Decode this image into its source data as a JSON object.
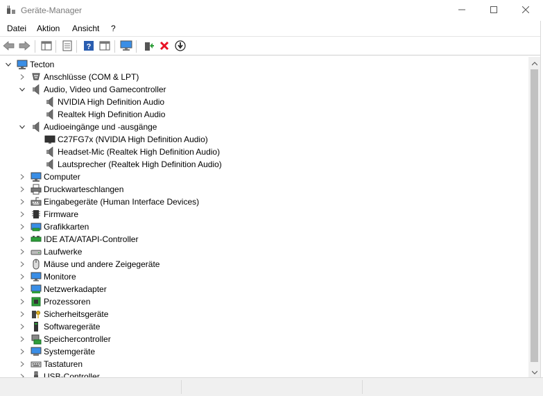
{
  "window": {
    "title": "Geräte-Manager",
    "icons": {
      "app": "device-manager-icon",
      "minimize": "minimize-icon",
      "maximize": "maximize-icon",
      "close": "close-icon"
    }
  },
  "menu": [
    "Datei",
    "Aktion",
    "Ansicht",
    "?"
  ],
  "toolbar": [
    "back-arrow-icon",
    "forward-arrow-icon",
    "show-hide-console-tree-icon",
    "properties-icon",
    "help-icon",
    "action-pane-icon",
    "scan-hardware-icon",
    "update-driver-icon",
    "uninstall-device-icon",
    "disable-device-icon"
  ],
  "tree": {
    "root": "Tecton",
    "items": [
      {
        "label": "Tecton",
        "level": 0,
        "state": "expanded",
        "icon": "computer-icon"
      },
      {
        "label": "Anschlüsse (COM & LPT)",
        "level": 1,
        "state": "collapsed",
        "icon": "port-icon"
      },
      {
        "label": "Audio, Video und Gamecontroller",
        "level": 1,
        "state": "expanded",
        "icon": "speaker-icon"
      },
      {
        "label": "NVIDIA High Definition Audio",
        "level": 2,
        "state": "leaf",
        "icon": "speaker-icon"
      },
      {
        "label": "Realtek High Definition Audio",
        "level": 2,
        "state": "leaf",
        "icon": "speaker-icon"
      },
      {
        "label": "Audioeingänge und -ausgänge",
        "level": 1,
        "state": "expanded",
        "icon": "speaker-icon"
      },
      {
        "label": "C27FG7x (NVIDIA High Definition Audio)",
        "level": 2,
        "state": "leaf",
        "icon": "monitor-dark-icon"
      },
      {
        "label": "Headset-Mic (Realtek High Definition Audio)",
        "level": 2,
        "state": "leaf",
        "icon": "speaker-icon"
      },
      {
        "label": "Lautsprecher (Realtek High Definition Audio)",
        "level": 2,
        "state": "leaf",
        "icon": "speaker-icon"
      },
      {
        "label": "Computer",
        "level": 1,
        "state": "collapsed",
        "icon": "computer-icon"
      },
      {
        "label": "Druckwarteschlangen",
        "level": 1,
        "state": "collapsed",
        "icon": "printer-icon"
      },
      {
        "label": "Eingabegeräte (Human Interface Devices)",
        "level": 1,
        "state": "collapsed",
        "icon": "hid-icon"
      },
      {
        "label": "Firmware",
        "level": 1,
        "state": "collapsed",
        "icon": "chip-icon"
      },
      {
        "label": "Grafikkarten",
        "level": 1,
        "state": "collapsed",
        "icon": "display-adapter-icon"
      },
      {
        "label": "IDE ATA/ATAPI-Controller",
        "level": 1,
        "state": "collapsed",
        "icon": "ide-controller-icon"
      },
      {
        "label": "Laufwerke",
        "level": 1,
        "state": "collapsed",
        "icon": "drive-icon"
      },
      {
        "label": "Mäuse und andere Zeigegeräte",
        "level": 1,
        "state": "collapsed",
        "icon": "mouse-icon"
      },
      {
        "label": "Monitore",
        "level": 1,
        "state": "collapsed",
        "icon": "monitor-icon"
      },
      {
        "label": "Netzwerkadapter",
        "level": 1,
        "state": "collapsed",
        "icon": "network-adapter-icon"
      },
      {
        "label": "Prozessoren",
        "level": 1,
        "state": "collapsed",
        "icon": "processor-icon"
      },
      {
        "label": "Sicherheitsgeräte",
        "level": 1,
        "state": "collapsed",
        "icon": "security-key-icon"
      },
      {
        "label": "Softwaregeräte",
        "level": 1,
        "state": "collapsed",
        "icon": "software-device-icon"
      },
      {
        "label": "Speichercontroller",
        "level": 1,
        "state": "collapsed",
        "icon": "storage-controller-icon"
      },
      {
        "label": "Systemgeräte",
        "level": 1,
        "state": "collapsed",
        "icon": "system-device-icon"
      },
      {
        "label": "Tastaturen",
        "level": 1,
        "state": "collapsed",
        "icon": "keyboard-icon"
      },
      {
        "label": "USB-Controller",
        "level": 1,
        "state": "collapsed",
        "icon": "usb-icon"
      }
    ]
  },
  "colors": {
    "scrollbar_thumb": "#c1c1c1",
    "scrollbar_track": "#f0f0f0",
    "uninstall_red": "#e81123",
    "help_blue": "#2a5db0"
  }
}
